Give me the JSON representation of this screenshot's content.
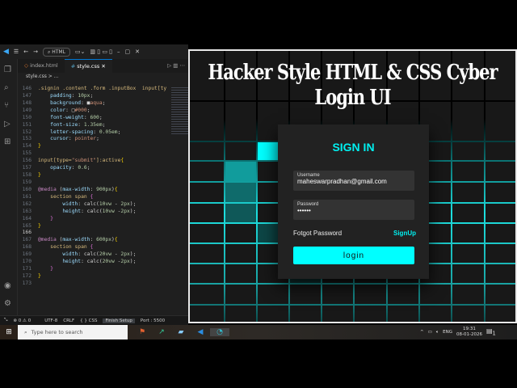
{
  "vscode": {
    "search": "HTML",
    "tabs": [
      {
        "label": "index.html",
        "icon": "html-icon"
      },
      {
        "label": "style.css",
        "icon": "css-icon"
      }
    ],
    "breadcrumb": "style.css > ...",
    "code": [
      {
        "n": "146",
        "t": [
          [
            "sel",
            ".signin .content .form .inputBox  input[ty"
          ]
        ]
      },
      {
        "n": "147",
        "t": [
          [
            "pun",
            "    "
          ],
          [
            "prop",
            "padding"
          ],
          [
            "pun",
            ": "
          ],
          [
            "num2",
            "10px"
          ],
          [
            "pun",
            ";"
          ]
        ]
      },
      {
        "n": "148",
        "t": [
          [
            "pun",
            "    "
          ],
          [
            "prop",
            "background"
          ],
          [
            "pun",
            ": ■"
          ],
          [
            "val",
            "aqua"
          ],
          [
            "pun",
            ";"
          ]
        ]
      },
      {
        "n": "149",
        "t": [
          [
            "pun",
            "    "
          ],
          [
            "prop",
            "color"
          ],
          [
            "pun",
            ": □"
          ],
          [
            "val",
            "#000"
          ],
          [
            "pun",
            ";"
          ]
        ]
      },
      {
        "n": "150",
        "t": [
          [
            "pun",
            "    "
          ],
          [
            "prop",
            "font-weight"
          ],
          [
            "pun",
            ": "
          ],
          [
            "num2",
            "600"
          ],
          [
            "pun",
            ";"
          ]
        ]
      },
      {
        "n": "151",
        "t": [
          [
            "pun",
            "    "
          ],
          [
            "prop",
            "font-size"
          ],
          [
            "pun",
            ": "
          ],
          [
            "num2",
            "1.35em"
          ],
          [
            "pun",
            ";"
          ]
        ]
      },
      {
        "n": "152",
        "t": [
          [
            "pun",
            "    "
          ],
          [
            "prop",
            "letter-spacing"
          ],
          [
            "pun",
            ": "
          ],
          [
            "num2",
            "0.05em"
          ],
          [
            "pun",
            ";"
          ]
        ]
      },
      {
        "n": "153",
        "t": [
          [
            "pun",
            "    "
          ],
          [
            "prop",
            "cursor"
          ],
          [
            "pun",
            ": "
          ],
          [
            "val",
            "pointer"
          ],
          [
            "pun",
            ";"
          ]
        ]
      },
      {
        "n": "154",
        "t": [
          [
            "br",
            "}"
          ]
        ]
      },
      {
        "n": "155",
        "t": []
      },
      {
        "n": "156",
        "t": [
          [
            "sel",
            "input[type="
          ],
          [
            "str",
            "\"submit\""
          ],
          [
            "sel",
            "]:active"
          ],
          [
            "br",
            "{"
          ]
        ]
      },
      {
        "n": "157",
        "t": [
          [
            "pun",
            "    "
          ],
          [
            "prop",
            "opacity"
          ],
          [
            "pun",
            ": "
          ],
          [
            "num2",
            "0.6"
          ],
          [
            "pun",
            ";"
          ]
        ]
      },
      {
        "n": "158",
        "t": [
          [
            "br",
            "}"
          ]
        ]
      },
      {
        "n": "159",
        "t": []
      },
      {
        "n": "160",
        "t": [
          [
            "kw",
            "@media"
          ],
          [
            "pun",
            " ("
          ],
          [
            "prop",
            "max-width"
          ],
          [
            "pun",
            ": "
          ],
          [
            "num2",
            "900px"
          ],
          [
            "pun",
            ")"
          ],
          [
            "br",
            "{"
          ]
        ]
      },
      {
        "n": "161",
        "t": [
          [
            "pun",
            "    "
          ],
          [
            "sel",
            "section span "
          ],
          [
            "br2",
            "{"
          ]
        ]
      },
      {
        "n": "162",
        "t": [
          [
            "pun",
            "        "
          ],
          [
            "prop",
            "width"
          ],
          [
            "pun",
            ": calc("
          ],
          [
            "num2",
            "10vw"
          ],
          [
            "pun",
            " - "
          ],
          [
            "num2",
            "2px"
          ],
          [
            "pun",
            ");"
          ]
        ]
      },
      {
        "n": "163",
        "t": [
          [
            "pun",
            "        "
          ],
          [
            "prop",
            "height"
          ],
          [
            "pun",
            ": calc("
          ],
          [
            "num2",
            "10vw"
          ],
          [
            "pun",
            " -"
          ],
          [
            "num2",
            "2px"
          ],
          [
            "pun",
            ");"
          ]
        ]
      },
      {
        "n": "164",
        "t": [
          [
            "pun",
            "    "
          ],
          [
            "br2",
            "}"
          ]
        ]
      },
      {
        "n": "165",
        "t": [
          [
            "br",
            "}"
          ]
        ]
      },
      {
        "n": "166",
        "t": []
      },
      {
        "n": "167",
        "t": [
          [
            "kw",
            "@media"
          ],
          [
            "pun",
            " ("
          ],
          [
            "prop",
            "max-width"
          ],
          [
            "pun",
            ": "
          ],
          [
            "num2",
            "600px"
          ],
          [
            "pun",
            ")"
          ],
          [
            "br",
            "{"
          ]
        ]
      },
      {
        "n": "168",
        "t": [
          [
            "pun",
            "    "
          ],
          [
            "sel",
            "section span "
          ],
          [
            "br2",
            "{"
          ]
        ]
      },
      {
        "n": "169",
        "t": [
          [
            "pun",
            "        "
          ],
          [
            "prop",
            "width"
          ],
          [
            "pun",
            ": calc("
          ],
          [
            "num2",
            "20vw"
          ],
          [
            "pun",
            " - "
          ],
          [
            "num2",
            "2px"
          ],
          [
            "pun",
            ");"
          ]
        ]
      },
      {
        "n": "170",
        "t": [
          [
            "pun",
            "        "
          ],
          [
            "prop",
            "height"
          ],
          [
            "pun",
            ": calc("
          ],
          [
            "num2",
            "20vw"
          ],
          [
            "pun",
            " -"
          ],
          [
            "num2",
            "2px"
          ],
          [
            "pun",
            ");"
          ]
        ]
      },
      {
        "n": "171",
        "t": [
          [
            "pun",
            "    "
          ],
          [
            "br2",
            "}"
          ]
        ]
      },
      {
        "n": "172",
        "t": [
          [
            "br",
            "}"
          ]
        ]
      },
      {
        "n": "173",
        "t": []
      }
    ],
    "status": {
      "errors": "0",
      "warnings": "0",
      "encoding": "UTF-8",
      "eol": "CRLF",
      "lang": "{ } CSS",
      "setup": "Finish Setup",
      "port": "Port : 5500"
    }
  },
  "page": {
    "headline": "Hacker Style HTML & CSS  Cyber Login UI",
    "title": "SIGN IN",
    "username_label": "Username",
    "username_value": "maheswarpradhan@gmail.com",
    "password_label": "Password",
    "password_value": "••••••",
    "forgot": "Fotgot Password",
    "signup": "SignUp",
    "login": "login"
  },
  "taskbar": {
    "search_placeholder": "Type here to search",
    "lang": "ENG",
    "time": "19:31",
    "date": "08-01-2026",
    "notifications": "1"
  },
  "colors": {
    "accent": "#00ffff",
    "bg": "#181818"
  }
}
